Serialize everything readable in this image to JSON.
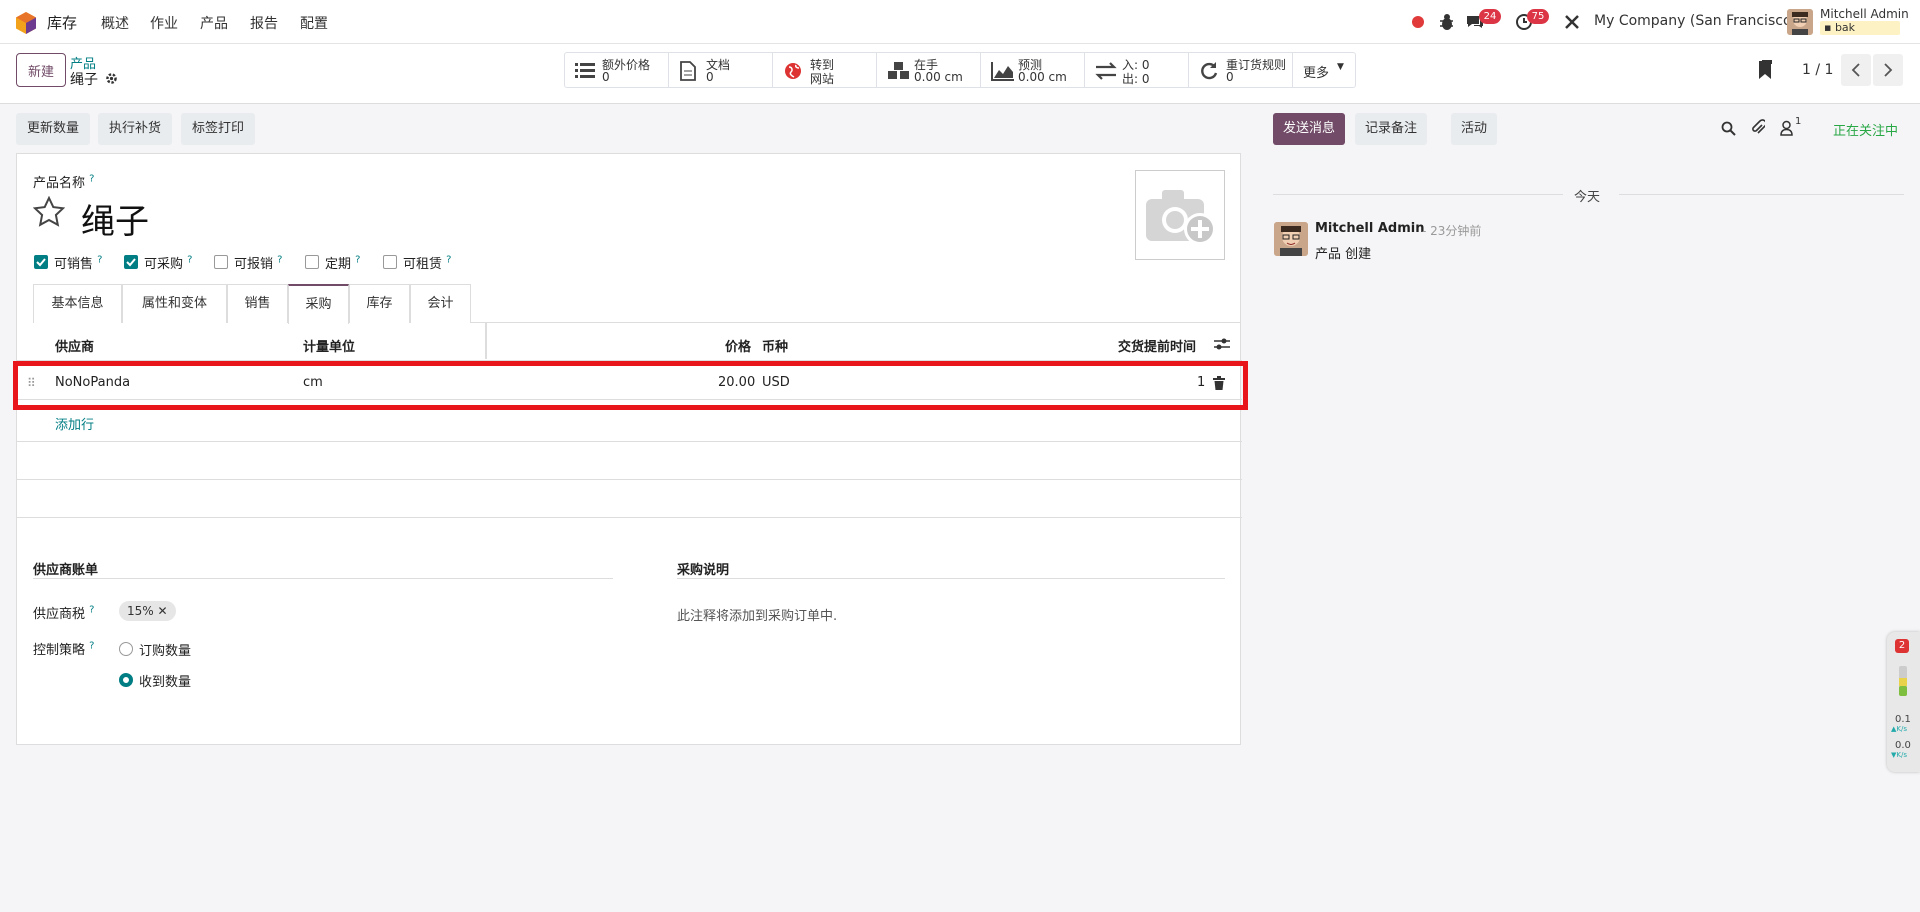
{
  "nav": {
    "app_name": "库存",
    "menu": [
      "概述",
      "作业",
      "产品",
      "报告",
      "配置"
    ],
    "messages_count": "24",
    "activities_count": "75",
    "company": "My Company (San Francisco)",
    "user_name": "Mitchell Admin",
    "db_name": "bak"
  },
  "control": {
    "new_label": "新建",
    "breadcrumb_parent": "产品",
    "breadcrumb_current": "绳子",
    "smart_buttons": [
      {
        "icon": "list-icon",
        "line1": "额外价格",
        "line2": "0"
      },
      {
        "icon": "document-icon",
        "line1": "文档",
        "line2": "0"
      },
      {
        "icon": "globe-icon",
        "line1": "转到",
        "line2": "网站"
      },
      {
        "icon": "cubes-icon",
        "line1": "在手",
        "line2": "0.00 cm"
      },
      {
        "icon": "area-chart-icon",
        "line1": "预测",
        "line2": "0.00 cm"
      },
      {
        "icon": "exchange-icon",
        "line1": "入:   0",
        "line2": "出:   0"
      },
      {
        "icon": "refresh-icon",
        "line1": "重订货规则",
        "line2": "0"
      }
    ],
    "more_label": "更多",
    "pager": "1 / 1"
  },
  "actions": {
    "update_qty": "更新数量",
    "replenish": "执行补货",
    "print_labels": "标签打印"
  },
  "form": {
    "name_label": "产品名称",
    "help_mark": "?",
    "product_name": "绳子",
    "checkboxes": [
      {
        "label": "可销售",
        "checked": true
      },
      {
        "label": "可采购",
        "checked": true
      },
      {
        "label": "可报销",
        "checked": false
      },
      {
        "label": "定期",
        "checked": false
      },
      {
        "label": "可租赁",
        "checked": false
      }
    ],
    "tabs": [
      "基本信息",
      "属性和变体",
      "销售",
      "采购",
      "库存",
      "会计"
    ],
    "active_tab": "采购",
    "table_headers": {
      "vendor": "供应商",
      "uom": "计量单位",
      "price": "价格",
      "currency": "币种",
      "lead_time": "交货提前时间"
    },
    "rows": [
      {
        "vendor": "NoNoPanda",
        "uom": "cm",
        "price": "20.00",
        "currency": "USD",
        "lead_time": "1"
      }
    ],
    "add_line": "添加行",
    "vendor_bills_title": "供应商账单",
    "vendor_taxes_label": "供应商税",
    "vendor_tax_tag": "15%",
    "control_policy_label": "控制策略",
    "policy_options": [
      {
        "label": "订购数量",
        "selected": false
      },
      {
        "label": "收到数量",
        "selected": true
      }
    ],
    "purchase_desc_title": "采购说明",
    "purchase_desc_placeholder": "此注释将添加到采购订单中."
  },
  "chatter": {
    "send_message": "发送消息",
    "log_note": "记录备注",
    "activities": "活动",
    "followers_count": "1",
    "following": "正在关注中",
    "today": "今天",
    "author": "Mitchell Admin",
    "time": "- 23分钟前",
    "body": "产品 创建"
  },
  "widget": {
    "badge": "2",
    "up_value": "0.1",
    "down_value": "0.0",
    "unit": "K/s"
  },
  "colors": {
    "brand": "#714b67",
    "accent": "#017e84",
    "highlight": "#e8161b"
  }
}
